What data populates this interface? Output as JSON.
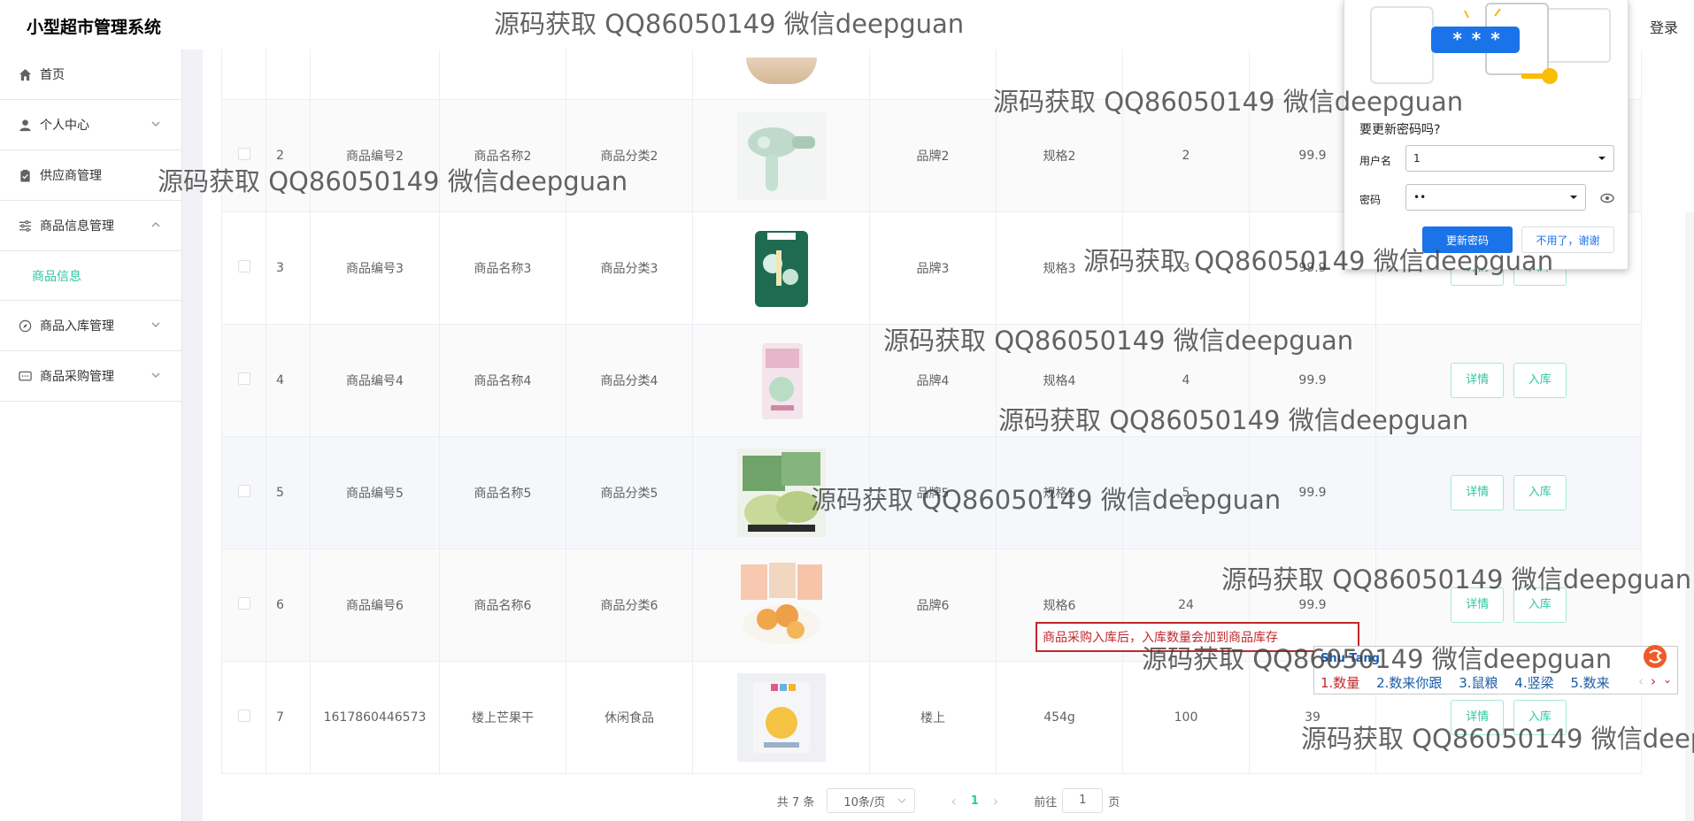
{
  "header": {
    "title": "小型超市管理系统",
    "logout": "登录"
  },
  "sidebar": {
    "items": [
      {
        "label": "首页",
        "icon": "home-icon",
        "has_arrow": false
      },
      {
        "label": "个人中心",
        "icon": "user-icon",
        "has_arrow": true
      },
      {
        "label": "供应商管理",
        "icon": "clipboard-icon",
        "has_arrow": false
      },
      {
        "label": "商品信息管理",
        "icon": "sliders-icon",
        "has_arrow": true,
        "expanded": true
      },
      {
        "label": "商品信息",
        "submenu": true,
        "active": true
      },
      {
        "label": "商品入库管理",
        "icon": "compass-icon",
        "has_arrow": true
      },
      {
        "label": "商品采购管理",
        "icon": "chat-icon",
        "has_arrow": true
      }
    ]
  },
  "table": {
    "rows": [
      {
        "idx": "2",
        "code": "商品编号2",
        "name": "商品名称2",
        "category": "商品分类2",
        "image": "hair-dryer-image",
        "brand": "品牌2",
        "spec": "规格2",
        "qty": "2",
        "price": "99.9",
        "show_buttons": false
      },
      {
        "idx": "3",
        "code": "商品编号3",
        "name": "商品名称3",
        "category": "商品分类3",
        "image": "rice-bag-image",
        "brand": "品牌3",
        "spec": "规格3",
        "qty": "3",
        "price": "99.9",
        "show_buttons": true
      },
      {
        "idx": "4",
        "code": "商品编号4",
        "name": "商品名称4",
        "category": "商品分类4",
        "image": "snack-pack-image",
        "brand": "品牌4",
        "spec": "规格4",
        "qty": "4",
        "price": "99.9",
        "show_buttons": true
      },
      {
        "idx": "5",
        "code": "商品编号5",
        "name": "商品名称5",
        "category": "商品分类5",
        "image": "green-cake-image",
        "brand": "品牌5",
        "spec": "规格5",
        "qty": "5",
        "price": "99.9",
        "show_buttons": true
      },
      {
        "idx": "6",
        "code": "商品编号6",
        "name": "商品名称6",
        "category": "商品分类6",
        "image": "crisps-image",
        "brand": "品牌6",
        "spec": "规格6",
        "qty": "24",
        "price": "99.9",
        "show_buttons": true
      },
      {
        "idx": "7",
        "code": "1617860446573",
        "name": "楼上芒果干",
        "category": "休闲食品",
        "image": "mango-snack-image",
        "brand": "楼上",
        "spec": "454g",
        "qty": "100",
        "price": "39",
        "show_buttons": true
      }
    ],
    "detail_label": "详情",
    "stock_in_label": "入库"
  },
  "pagination": {
    "total": "共 7 条",
    "page_size": "10条/页",
    "current_page": "1",
    "goto_prefix": "前往",
    "goto_value": "1",
    "goto_suffix": "页"
  },
  "password_popup": {
    "title": "要更新密码吗?",
    "username_label": "用户名",
    "username_value": "1",
    "password_label": "密码",
    "password_value": "••",
    "update_button": "更新密码",
    "decline_button": "不用了，谢谢",
    "illustration_text": "* * *"
  },
  "tooltip": {
    "text": "商品采购入库后，入库数量会加到商品库存"
  },
  "ime": {
    "brand": "Shu Tang",
    "candidates": [
      "1.数量",
      "2.数来你跟",
      "3.鼠粮",
      "4.竖梁",
      "5.数来"
    ]
  },
  "watermark": {
    "text": "源码获取 QQ86050149 微信deepguan"
  },
  "colors": {
    "accent": "#2fc6a4",
    "popup_blue": "#1a73e8",
    "tooltip_red": "#c0282d"
  }
}
